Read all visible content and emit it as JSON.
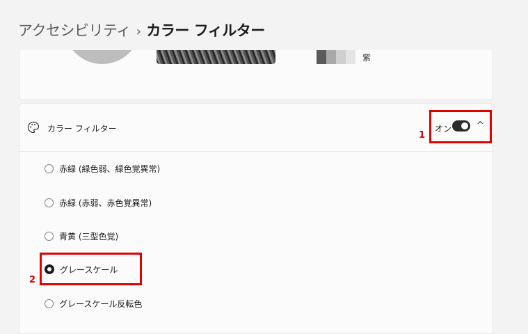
{
  "breadcrumb": {
    "parent": "アクセシビリティ",
    "separator": "›",
    "current": "カラー フィルター"
  },
  "preview": {
    "swatch_colors": [
      "#5b5b5b",
      "#a9a9a9",
      "#cfcfcf",
      "#e4e4e4"
    ],
    "swatch_label": "紫"
  },
  "color_filter": {
    "title": "カラー フィルター",
    "toggle_state": "オン",
    "toggle_on": true,
    "chevron": "^",
    "options": [
      {
        "label": "赤緑 (緑色弱、緑色覚異常)",
        "selected": false
      },
      {
        "label": "赤緑 (赤弱、赤色覚異常)",
        "selected": false
      },
      {
        "label": "青黄 (三型色覚)",
        "selected": false
      },
      {
        "label": "グレースケール",
        "selected": true
      },
      {
        "label": "グレースケール反転色",
        "selected": false
      }
    ]
  },
  "annotations": {
    "marker_1": "1",
    "marker_2": "2",
    "color": "#e00000"
  }
}
